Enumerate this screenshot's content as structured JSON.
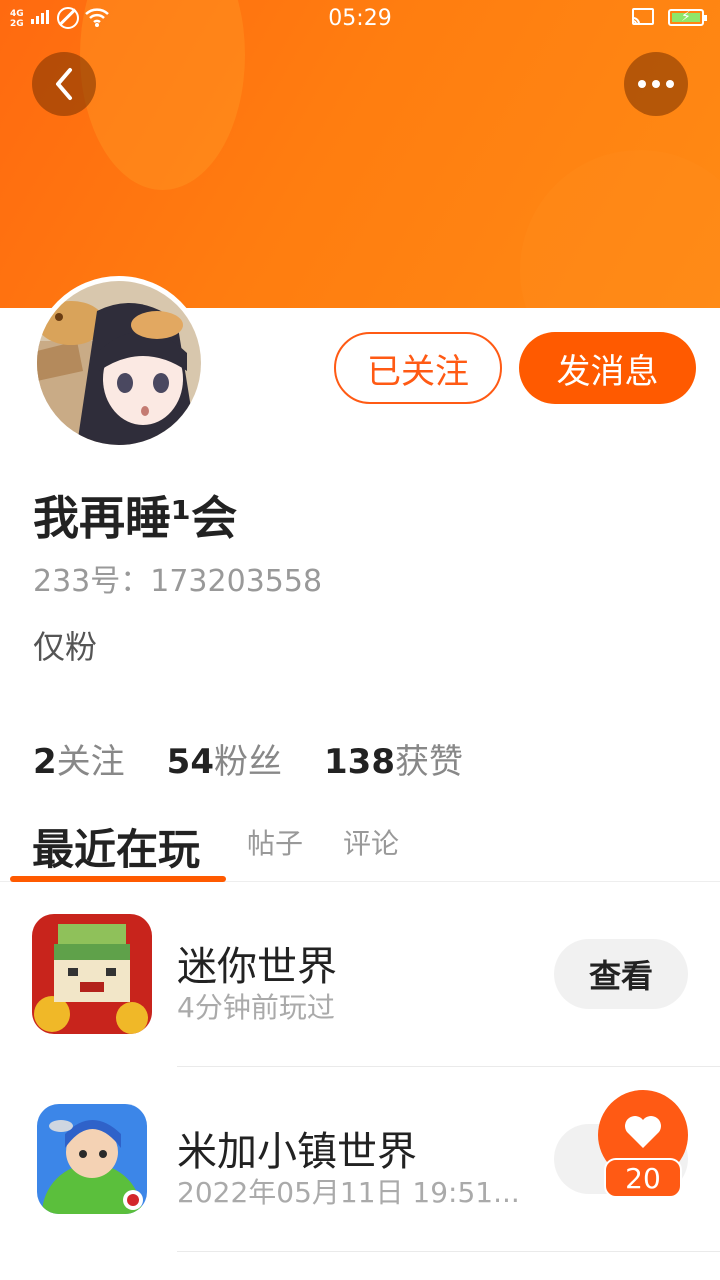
{
  "status_bar": {
    "time": "05:29",
    "network_label": "4G\n2G"
  },
  "header": {
    "back_icon": "chevron-left-icon",
    "more_icon": "more-dots-icon",
    "banner_color": "#ff7a10"
  },
  "profile": {
    "follow_button": "已关注",
    "message_button": "发消息",
    "username": "我再睡¹会",
    "user_id": "233号：173203558",
    "bio": "仅粉",
    "stats": [
      {
        "num": "2",
        "label": "关注"
      },
      {
        "num": "54",
        "label": "粉丝"
      },
      {
        "num": "138",
        "label": "获赞"
      }
    ]
  },
  "tabs": {
    "active": "最近在玩",
    "posts": "帖子",
    "comments": "评论"
  },
  "games": [
    {
      "title": "迷你世界",
      "subtitle": "4分钟前玩过",
      "button": "查看"
    },
    {
      "title": "米加小镇世界",
      "subtitle": "2022年05月11日 19:51...",
      "button": "查"
    }
  ],
  "like": {
    "count": "20",
    "icon": "heart-icon"
  },
  "colors": {
    "accent": "#ff5a00"
  }
}
